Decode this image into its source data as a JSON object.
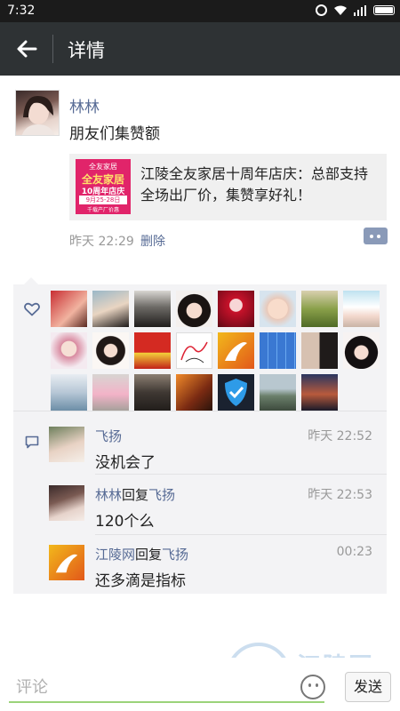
{
  "status_bar": {
    "time": "7:32"
  },
  "header": {
    "title": "详情"
  },
  "post": {
    "author": "林林",
    "text": "朋友们集赞额",
    "link": {
      "title": "江陵全友家居十周年店庆：总部支持全场出厂价，集赞享好礼！",
      "thumb": {
        "brand": "全友家居",
        "headline": "10周年店庆",
        "dates": "9月25-28日",
        "footer": "千载产厂价惠",
        "badge": "全友家居"
      }
    },
    "time": "昨天 22:29",
    "delete_label": "删除"
  },
  "likes": {
    "avatars": [
      {
        "icon": "avatar-red-woman"
      },
      {
        "icon": "avatar-beach"
      },
      {
        "icon": "avatar-man-glasses"
      },
      {
        "icon": "avatar-girl-bangs"
      },
      {
        "icon": "avatar-anime-red"
      },
      {
        "icon": "avatar-baby"
      },
      {
        "icon": "avatar-grass"
      },
      {
        "icon": "avatar-sky-girl"
      },
      {
        "icon": "avatar-woman-pink"
      },
      {
        "icon": "avatar-woman-hat"
      },
      {
        "icon": "avatar-red-flag"
      },
      {
        "icon": "avatar-sketch"
      },
      {
        "icon": "avatar-kangaroo-logo"
      },
      {
        "icon": "avatar-blue-grid"
      },
      {
        "icon": "avatar-couple"
      },
      {
        "icon": "avatar-woman-dark"
      },
      {
        "icon": "avatar-tiles"
      },
      {
        "icon": "avatar-child-pink"
      },
      {
        "icon": "avatar-men-group"
      },
      {
        "icon": "avatar-orange-art"
      },
      {
        "icon": "avatar-shield"
      },
      {
        "icon": "avatar-landscape"
      },
      {
        "icon": "avatar-night-city"
      }
    ]
  },
  "comments": [
    {
      "author": "飞扬",
      "reply_word": "",
      "reply_to": "",
      "time": "昨天 22:52",
      "text": "没机会了"
    },
    {
      "author": "林林",
      "reply_word": "回复",
      "reply_to": "飞扬",
      "time": "昨天 22:53",
      "text": "120个么"
    },
    {
      "author": "江陵网",
      "reply_word": "回复",
      "reply_to": "飞扬",
      "time": "00:23",
      "text": "还多滴是指标"
    }
  ],
  "composer": {
    "placeholder": "评论",
    "send_label": "发送"
  },
  "watermark": {
    "text": "江陵网",
    "url": "jiangling"
  },
  "colors": {
    "link_blue": "#576b95",
    "header_bg": "#2e3234",
    "input_accent": "#9bd37a"
  }
}
